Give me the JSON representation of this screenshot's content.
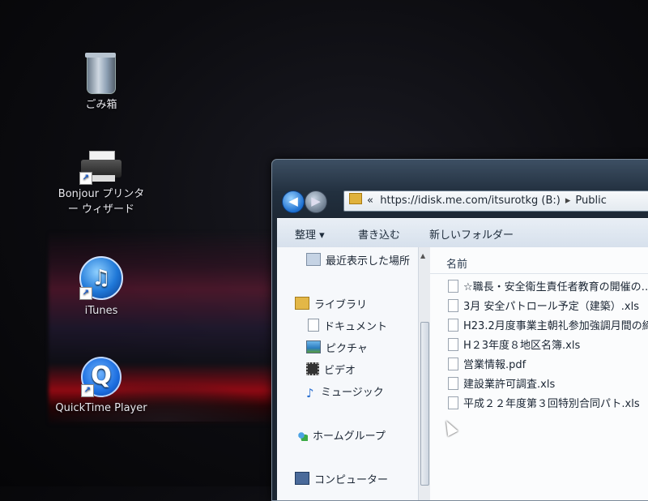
{
  "desktop": {
    "icons": [
      {
        "label": "ごみ箱",
        "icon": "recycle-bin-icon"
      },
      {
        "label_line1": "Bonjour プリンタ",
        "label_line2": "ー ウィザード",
        "icon": "printer-icon"
      },
      {
        "label": "iTunes",
        "icon": "itunes-icon"
      },
      {
        "label": "QuickTime Player",
        "icon": "quicktime-icon"
      }
    ]
  },
  "explorer": {
    "address": {
      "chevron": "«",
      "path": "https://idisk.me.com/itsurotkg (B:)",
      "separator": "▸",
      "current": "Public"
    },
    "nav": {
      "back": "◀",
      "forward": "▶"
    },
    "toolbar": {
      "organize": "整理 ▾",
      "burn": "書き込む",
      "new_folder": "新しいフォルダー"
    },
    "navpane": {
      "recent": "最近表示した場所",
      "libraries": "ライブラリ",
      "documents": "ドキュメント",
      "pictures": "ピクチャ",
      "videos": "ビデオ",
      "music": "ミュージック",
      "homegroup": "ホームグループ",
      "computer": "コンピューター"
    },
    "filepane": {
      "column_name": "名前",
      "files": [
        "☆職長・安全衛生責任者教育の開催の…",
        "3月 安全パトロール予定（建築）.xls",
        "H23.2月度事業主朝礼参加強調月間の締",
        "H２3年度８地区名簿.xls",
        "営業情報.pdf",
        "建設業許可調査.xls",
        "平成２２年度第３回特別合同パト.xls"
      ]
    }
  },
  "colors": {
    "desktop_bg": "#0c0c10",
    "window_frame": "#2a3a4e",
    "toolbar_bg": "#dde6f0",
    "pane_bg": "#f6f8fb"
  }
}
